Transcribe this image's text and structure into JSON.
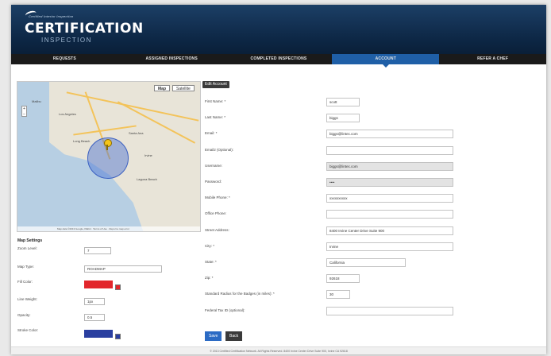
{
  "header": {
    "tagline": "Certified Interior Inspection",
    "title": "CERTIFICATION",
    "subtitle": "INSPECTION"
  },
  "nav": {
    "tabs": [
      {
        "label": "REQUESTS",
        "active": false
      },
      {
        "label": "ASSIGNED INSPECTIONS",
        "active": false
      },
      {
        "label": "COMPLETED INSPECTIONS",
        "active": false
      },
      {
        "label": "ACCOUNT",
        "active": true
      },
      {
        "label": "REFER A CHEF",
        "active": false
      }
    ]
  },
  "map": {
    "map_button": "Map",
    "satellite_button": "Satellite",
    "zoom_in": "+",
    "zoom_out": "−",
    "cities": [
      "Los Angeles",
      "Long Beach",
      "Santa Ana",
      "Irvine",
      "Malibu",
      "Laguna Beach"
    ],
    "footer": "Map data ©2013 Google, INEGI · Terms of Use · Report a map error"
  },
  "map_settings": {
    "title": "Map Settings",
    "zoom_label": "Zoom Level:",
    "zoom_value": "7",
    "map_type_label": "Map Type:",
    "map_type_value": "ROADMAP",
    "fill_color_label": "Fill Color:",
    "fill_color_value": "FF0000",
    "fill_color": "#e2262b",
    "line_weight_label": "Line Weight:",
    "line_weight_value": "1px",
    "opacity_label": "Opacity:",
    "opacity_value": "0.5",
    "stroke_color_label": "Stroke Color:",
    "stroke_color_value": "0000FF",
    "stroke_color": "#2a3fa0"
  },
  "account": {
    "edit_button": "Edit Account",
    "fields": [
      {
        "label": "First Name: *",
        "value": "scott",
        "width": "short"
      },
      {
        "label": "Last Name: *",
        "value": "biggs",
        "width": "short"
      },
      {
        "label": "Email: *",
        "value": "biggs@lintec.com",
        "width": "long"
      },
      {
        "label": "Email2 (Optional):",
        "value": "",
        "width": "long"
      },
      {
        "label": "Username:",
        "value": "biggs@lintec.com",
        "width": "long",
        "disabled": true
      },
      {
        "label": "Password:",
        "value": "••••",
        "width": "long",
        "disabled": true
      },
      {
        "label": "Mobile Phone: *",
        "value": "xxxxxxxxxx",
        "width": "long"
      },
      {
        "label": "Office Phone:",
        "value": "",
        "width": "long"
      },
      {
        "label": "Street Address:",
        "value": "8400 Irvine Center Drive Suite 900",
        "width": "xlong"
      },
      {
        "label": "City: *",
        "value": "Irvine",
        "width": "long"
      },
      {
        "label": "State: *",
        "value": "California",
        "width": "select"
      },
      {
        "label": "Zip: *",
        "value": "92618",
        "width": "short"
      },
      {
        "label": "Standard Radius for the Badges (in miles): *",
        "value": "30",
        "width": "tiny"
      },
      {
        "label": "Federal Tax ID (optional):",
        "value": "",
        "width": "long"
      }
    ],
    "save_button": "Save",
    "back_button": "Back"
  },
  "footer": {
    "text": "© 2013 Certified Certification Network. All Rights Reserved. 8400 Irvine Center Drive Suite 900, Irvine CA 92618"
  },
  "colors": {
    "nav_active": "#1f5fa7",
    "save_button": "#2c6bc4",
    "back_button": "#3a3a3a"
  }
}
